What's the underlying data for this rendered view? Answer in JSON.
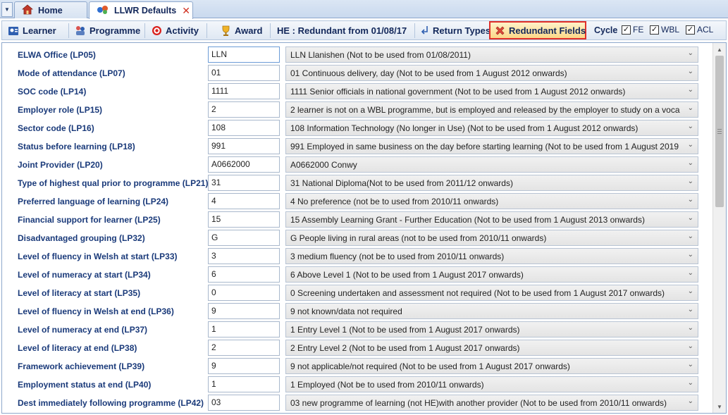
{
  "tabs": [
    {
      "label": "Home",
      "icon": "home-icon"
    },
    {
      "label": "LLWR Defaults",
      "icon": "llwr-icon",
      "close": "✕"
    }
  ],
  "toolbar": {
    "learner": "Learner",
    "programme": "Programme",
    "activity": "Activity",
    "award": "Award",
    "he_redundant": "HE : Redundant from 01/08/17",
    "return_types": "Return Types",
    "redundant_fields": "Redundant Fields",
    "cycle_label": "Cycle",
    "cycles": [
      {
        "label": "FE",
        "checked": true
      },
      {
        "label": "WBL",
        "checked": true
      },
      {
        "label": "ACL",
        "checked": true
      }
    ],
    "highlight_color": "#e0302a"
  },
  "fields": [
    {
      "label": "ELWA Office (LP05)",
      "code": "LLN",
      "desc": "LLN   Llanishen (Not to be used from 01/08/2011)"
    },
    {
      "label": "Mode of attendance (LP07)",
      "code": "01",
      "desc": "01   Continuous delivery, day (Not to be used from 1 August 2012 onwards)"
    },
    {
      "label": "SOC code (LP14)",
      "code": "1111",
      "desc": "1111   Senior officials in national government (Not to be used from 1 August 2012 onwards)"
    },
    {
      "label": "Employer role (LP15)",
      "code": "2",
      "desc": "2   learner is not on a WBL programme, but is employed and released by the employer to study on a voca"
    },
    {
      "label": "Sector code (LP16)",
      "code": "108",
      "desc": "108   Information Technology (No longer in Use) (Not to be used from 1 August 2012 onwards)"
    },
    {
      "label": "Status before learning (LP18)",
      "code": "991",
      "desc": "991   Employed in same business on the day before starting learning (Not to be used from 1 August 2019"
    },
    {
      "label": "Joint Provider (LP20)",
      "code": "A0662000",
      "desc": "A0662000   Conwy"
    },
    {
      "label": "Type of highest qual prior to programme (LP21)",
      "code": "31",
      "desc": "31   National Diploma(Not to be used from 2011/12 onwards)"
    },
    {
      "label": "Preferred language of learning (LP24)",
      "code": "4",
      "desc": "4   No preference (not be to used from 2010/11 onwards)"
    },
    {
      "label": "Financial support for learner (LP25)",
      "code": "15",
      "desc": "15   Assembly Learning Grant - Further Education (Not to be used from 1 August 2013 onwards)"
    },
    {
      "label": "Disadvantaged grouping (LP32)",
      "code": "G",
      "desc": "G   People living in rural areas (not to be used from 2010/11 onwards)"
    },
    {
      "label": "Level of fluency in Welsh at start (LP33)",
      "code": "3",
      "desc": "3   medium fluency (not be to used from 2010/11 onwards)"
    },
    {
      "label": "Level of numeracy at start (LP34)",
      "code": "6",
      "desc": "6   Above Level 1 (Not to be used from 1 August 2017 onwards)"
    },
    {
      "label": "Level of literacy at start (LP35)",
      "code": "0",
      "desc": "0   Screening undertaken and assessment not required (Not to be used from 1 August 2017 onwards)"
    },
    {
      "label": "Level of fluency in Welsh at end (LP36)",
      "code": "9",
      "desc": "9   not known/data not required"
    },
    {
      "label": "Level of numeracy at end (LP37)",
      "code": "1",
      "desc": "1   Entry Level 1 (Not to be used from 1 August 2017 onwards)"
    },
    {
      "label": "Level of literacy at end (LP38)",
      "code": "2",
      "desc": "2   Entry Level 2 (Not to be used from 1 August 2017 onwards)"
    },
    {
      "label": "Framework achievement (LP39)",
      "code": "9",
      "desc": "9   not applicable/not required (Not to be used from 1 August 2017 onwards)"
    },
    {
      "label": "Employment status at end (LP40)",
      "code": "1",
      "desc": "1   Employed (Not be to used from 2010/11 onwards)"
    },
    {
      "label": "Dest immediately following programme (LP42)",
      "code": "03",
      "desc": "03   new programme of learning (not HE)with another provider (Not to be used from 2010/11 onwards)"
    }
  ]
}
